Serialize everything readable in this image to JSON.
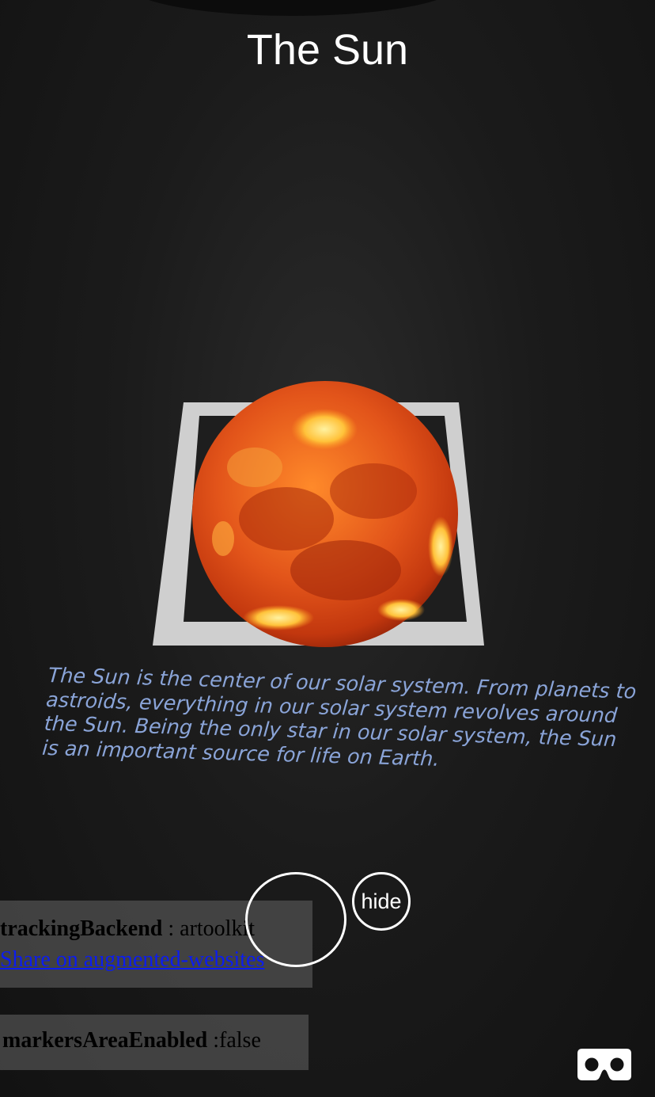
{
  "scene": {
    "title": "The Sun",
    "description": "The Sun is the center of our solar system. From planets to astroids, everything in our solar system revolves around the Sun. Being the only star in our solar system, the Sun is an important source for life on Earth."
  },
  "debug_panel": {
    "tracking_key": "trackingBackend",
    "tracking_value": " : artoolkit",
    "share_link": "Share on augmented-websites"
  },
  "markers_panel": {
    "key": "markersAreaEnabled",
    "value": " :false"
  },
  "controls": {
    "hide_label": "hide",
    "vr_icon": "vr-goggles-icon",
    "capture_icon": "capture-ring-icon"
  },
  "colors": {
    "description_text": "#8aa4d8",
    "link": "#0b1cf0",
    "sun_core": "#f06a14",
    "sun_dark": "#a8280c",
    "sun_bright": "#ffd35a"
  }
}
